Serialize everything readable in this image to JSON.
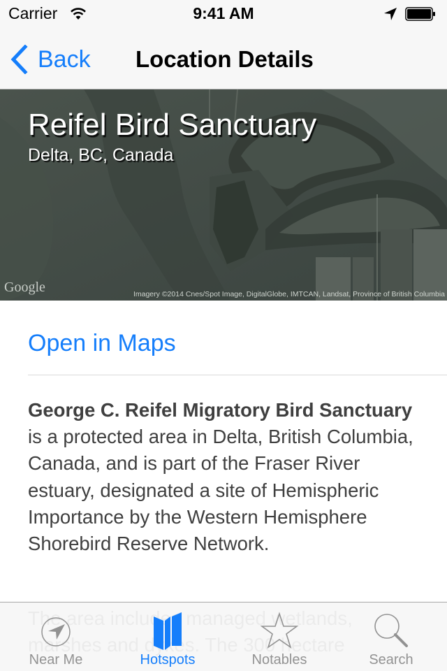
{
  "status_bar": {
    "carrier": "Carrier",
    "time": "9:41 AM",
    "icons": [
      "wifi-icon",
      "location-arrow-icon",
      "battery-icon"
    ]
  },
  "nav_bar": {
    "back_label": "Back",
    "title": "Location Details"
  },
  "map_header": {
    "place_name": "Reifel Bird Sanctuary",
    "region": "Delta, BC, Canada",
    "provider_logo": "Google",
    "imagery_credit": "Imagery ©2014 Cnes/Spot Image, DigitalGlobe, IMTCAN, Landsat, Province of British Columbia"
  },
  "content": {
    "open_in_maps_label": "Open in Maps",
    "description_bold": "George C. Reifel Migratory Bird Sanctuary",
    "description_rest": " is a protected area in Delta, British Columbia, Canada, and is part of the Fraser River estuary, designated a site of Hemispheric Importance by the Western Hemisphere Shorebird Reserve Network.",
    "description_continued": "The area includes managed wetlands, marshes and dykes. The 300 hectare"
  },
  "tab_bar": {
    "active_tab": "Hotspots",
    "tabs": [
      {
        "label": "Near Me",
        "icon": "near-me-icon"
      },
      {
        "label": "Hotspots",
        "icon": "map-icon"
      },
      {
        "label": "Notables",
        "icon": "star-icon"
      },
      {
        "label": "Search",
        "icon": "search-icon"
      }
    ]
  },
  "colors": {
    "accent": "#157efb",
    "inactive_tab": "#929292",
    "body_text": "#3f3f3f"
  }
}
